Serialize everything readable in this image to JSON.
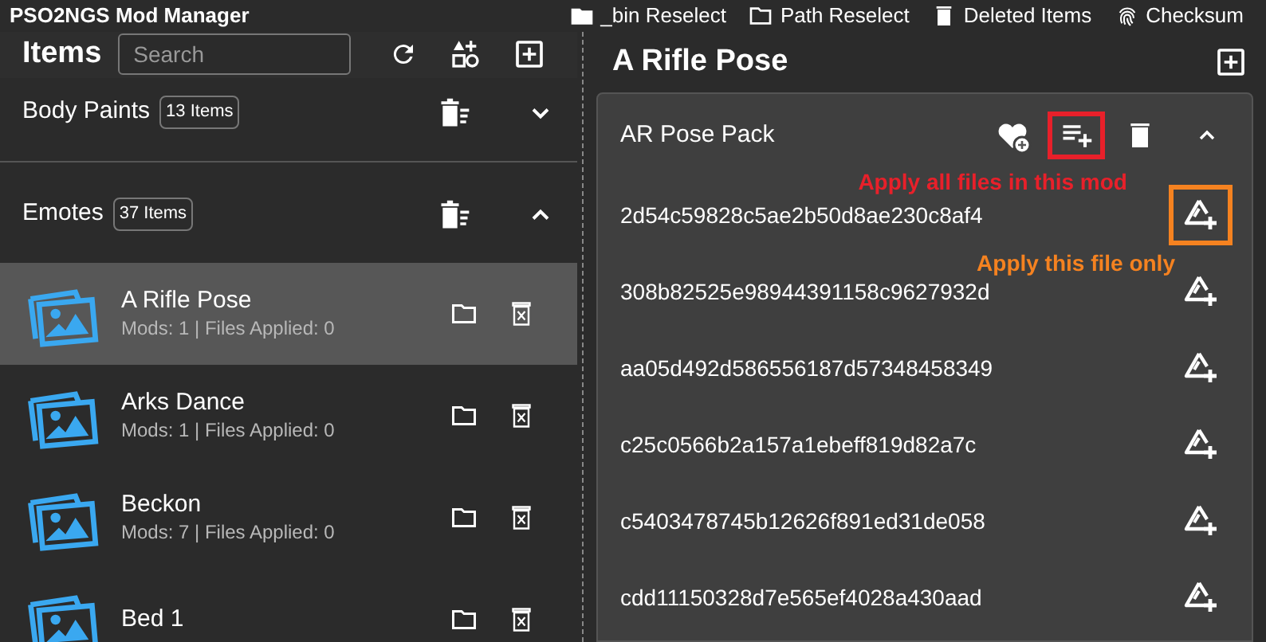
{
  "window": {
    "title": "PSO2NGS Mod Manager"
  },
  "toolbar": [
    {
      "kind": "folder",
      "label": "_bin Reselect"
    },
    {
      "kind": "folder-outline",
      "label": "Path Reselect"
    },
    {
      "kind": "trash",
      "label": "Deleted Items"
    },
    {
      "kind": "fingerprint",
      "label": "Checksum"
    }
  ],
  "items_panel": {
    "title": "Items",
    "search": {
      "placeholder": "Search"
    },
    "categories": [
      {
        "name": "Body Paints",
        "count": "13 Items",
        "expanded": false
      },
      {
        "name": "Emotes",
        "count": "37 Items",
        "expanded": true,
        "items": [
          {
            "name": "A Rifle Pose",
            "details": "Mods: 1 | Files Applied: 0",
            "selected": true
          },
          {
            "name": "Arks Dance",
            "details": "Mods: 1 | Files Applied: 0",
            "selected": false
          },
          {
            "name": "Beckon",
            "details": "Mods: 7 | Files Applied: 0",
            "selected": false
          },
          {
            "name": "Bed 1",
            "selected": false
          }
        ]
      }
    ]
  },
  "detail_panel": {
    "title": "A Rifle Pose",
    "mod": {
      "name": "AR Pose Pack",
      "expanded": true,
      "apply_all_highlighted": true,
      "files": [
        {
          "name": "2d54c59828c5ae2b50d8ae230c8af4",
          "highlighted": true
        },
        {
          "name": "308b82525e98944391158c9627932d",
          "highlighted": false
        },
        {
          "name": "aa05d492d586556187d57348458349",
          "highlighted": false
        },
        {
          "name": "c25c0566b2a157a1ebeff819d82a7c",
          "highlighted": false
        },
        {
          "name": "c5403478745b12626f891ed31de058",
          "highlighted": false
        },
        {
          "name": "cdd11150328d7e565ef4028a430aad",
          "highlighted": false
        }
      ]
    }
  },
  "annotations": [
    {
      "kind": "apply_all",
      "text": "Apply all files in this mod",
      "color": "#e8202a"
    },
    {
      "kind": "apply_file",
      "text": "Apply this file only",
      "color": "#f58220"
    }
  ]
}
